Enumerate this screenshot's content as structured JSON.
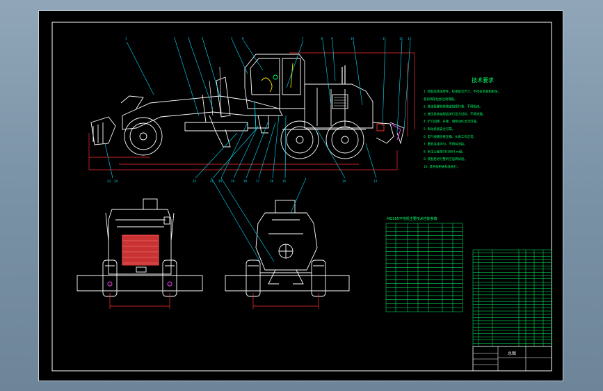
{
  "colors": {
    "background": "#7e96aa",
    "sheet": "#000000",
    "outline": "#ffffff",
    "leader": "#00e5ff",
    "dimension": "#ff3030",
    "notes": "#00ff6a",
    "accent_yellow": "#ffea00",
    "accent_magenta": "#ff40ff"
  },
  "tech": {
    "title": "技术要求",
    "items": [
      "1. 装配前清洗零件，检查配合尺寸，不得有毛刺和损伤；",
      "   各润滑部位加注润滑脂。",
      "2. 各连接螺栓按规定扭矩拧紧，不得松动。",
      "3. 液压系统装配后进行压力试验，不得渗漏。",
      "4. 铲刀回转、升降、侧移动作灵活可靠。",
      "5. 制动系统安全可靠。",
      "6. 电气线路连接正确，仪表工作正常。",
      "7. 整机涂漆均匀，不得有流挂。",
      "8. 未注公差按GB1804-m级。",
      "9. 装配后进行整机空运转试验。",
      "10. 其余按相关标准执行。"
    ]
  },
  "params": {
    "title": "MG165平地机主要技术性能参数"
  },
  "title_block": {
    "name": "总图"
  }
}
